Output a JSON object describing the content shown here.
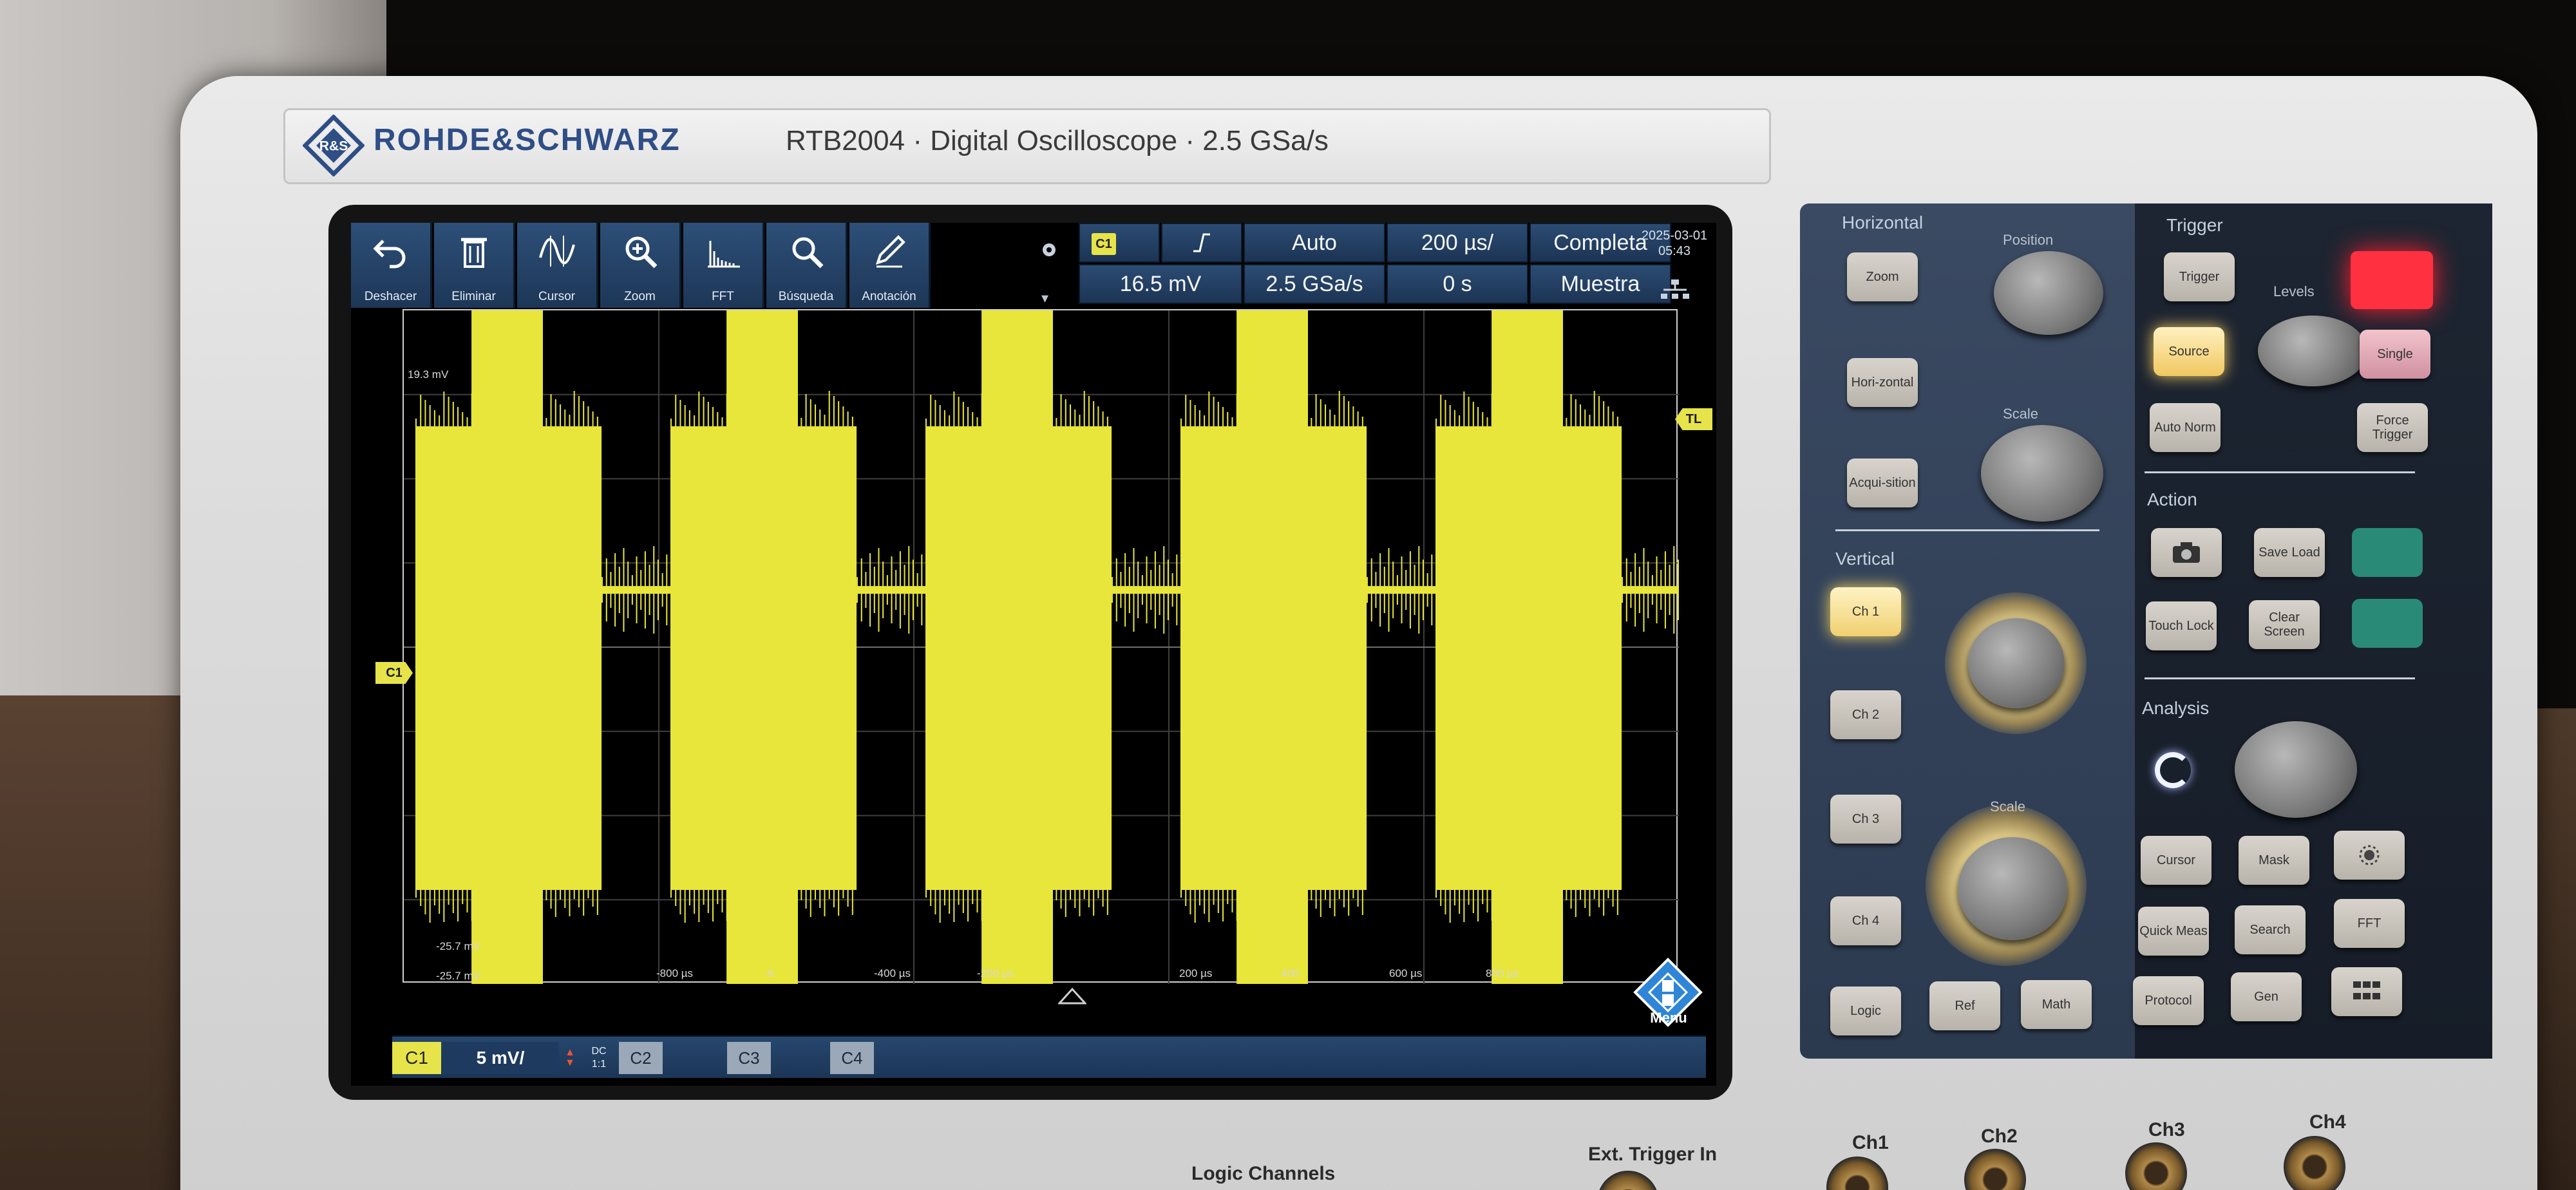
{
  "device": {
    "brand": "ROHDE&SCHWARZ",
    "model_line": "RTB2004 · Digital Oscilloscope · 2.5 GSa/s"
  },
  "toolbar": {
    "items": [
      {
        "label": "Deshacer",
        "icon": "undo-icon"
      },
      {
        "label": "Eliminar",
        "icon": "trash-icon"
      },
      {
        "label": "Cursor",
        "icon": "cursor-icon"
      },
      {
        "label": "Zoom",
        "icon": "zoom-icon"
      },
      {
        "label": "FFT",
        "icon": "fft-icon"
      },
      {
        "label": "Búsqueda",
        "icon": "search-icon"
      },
      {
        "label": "Anotación",
        "icon": "pencil-icon"
      }
    ]
  },
  "status": {
    "trigger_source": "C1",
    "trigger_slope_icon": "rising-edge-icon",
    "trigger_level": "16.5 mV",
    "trigger_mode": "Auto",
    "sample_rate": "2.5 GSa/s",
    "time_scale": "200 µs/",
    "horizontal_position": "0 s",
    "acquisition_mode": "Completa",
    "acquisition_type": "Muestra",
    "date": "2025-03-01",
    "time": "05:43"
  },
  "waveform": {
    "color": "#e8e63a",
    "top_level_label": "19.3 mV",
    "low_level_label_1": "-25.7 mV",
    "low_level_label_2": "-25.7 mV",
    "bursts": 5,
    "channel_marker": "C1",
    "trigger_level_marker": "TL",
    "time_axis_labels": [
      "-800 µs",
      "-6",
      "-400 µs",
      "-200 µs",
      "200 µs",
      "400",
      "600 µs",
      "800 µs"
    ]
  },
  "menu_button": {
    "label": "Menu"
  },
  "channel_bar": {
    "c1": {
      "label": "C1",
      "scale": "5 mV/",
      "coupling_top": "DC",
      "coupling_bottom": "1:1",
      "color": "#e8e63a"
    },
    "c2": {
      "label": "C2"
    },
    "c3": {
      "label": "C3"
    },
    "c4": {
      "label": "C4"
    }
  },
  "panel": {
    "horizontal": {
      "title": "Horizontal",
      "buttons": [
        "Zoom",
        "Hori-zontal",
        "Acqui-sition"
      ],
      "position_label": "Position",
      "scale_label": "Scale"
    },
    "vertical": {
      "title": "Vertical",
      "buttons": [
        "Ch 1",
        "Ch 2",
        "Ch 3",
        "Ch 4"
      ],
      "scale_label": "Scale"
    },
    "trigger": {
      "title": "Trigger",
      "buttons": [
        "Trigger",
        "Source",
        "Auto Norm",
        "Single",
        "Force Trigger"
      ],
      "levels_label": "Levels"
    },
    "action": {
      "title": "Action",
      "buttons": [
        "Save Load",
        "Touch Lock",
        "Clear Screen"
      ]
    },
    "analysis": {
      "title": "Analysis",
      "buttons": [
        "Cursor",
        "Quick Meas",
        "Search",
        "FFT",
        "Protocol",
        "Gen",
        "Mask"
      ]
    },
    "bottom_buttons": [
      "Logic",
      "Ref",
      "Math"
    ]
  },
  "connectors": {
    "logic": "Logic Channels",
    "ext_trigger": "Ext. Trigger In",
    "ch1": "Ch1",
    "ch2": "Ch2",
    "ch3": "Ch3",
    "ch4": "Ch4"
  }
}
